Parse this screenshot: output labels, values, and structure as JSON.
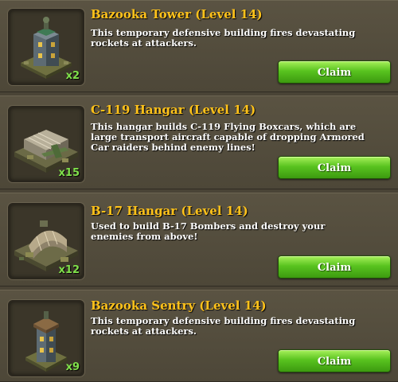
{
  "rewards": [
    {
      "title": "Bazooka Tower (Level 14)",
      "description": "This temporary defensive building fires devastating rockets at attackers.",
      "count": "x2",
      "claim_label": "Claim",
      "icon": "bazooka-tower-icon"
    },
    {
      "title": "C-119 Hangar (Level 14)",
      "description": "This hangar builds C-119 Flying Boxcars, which are large transport aircraft capable of dropping Armored Car raiders behind enemy lines!",
      "count": "x15",
      "claim_label": "Claim",
      "icon": "c119-hangar-icon"
    },
    {
      "title": "B-17 Hangar (Level 14)",
      "description": "Used to build B-17 Bombers and destroy your enemies from above!",
      "count": "x12",
      "claim_label": "Claim",
      "icon": "b17-hangar-icon"
    },
    {
      "title": "Bazooka Sentry (Level 14)",
      "description": "This temporary defensive building fires devastating rockets at attackers.",
      "count": "x9",
      "claim_label": "Claim",
      "icon": "bazooka-sentry-icon"
    }
  ],
  "colors": {
    "title": "#ffc21a",
    "count": "#7fe04a",
    "claim_button": "#59c31f"
  }
}
